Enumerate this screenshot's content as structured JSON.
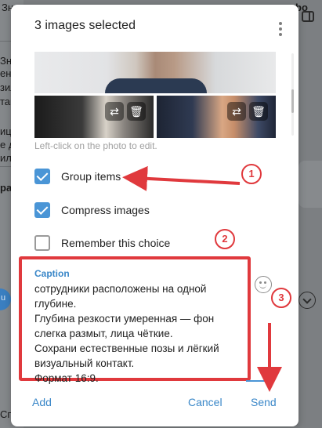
{
  "background": {
    "left_fragments": [
      "Зн",
      "ен",
      "зил",
      "тан",
      "иц",
      "е д",
      "ил,",
      "ра",
      "u",
      "Сп"
    ],
    "right_label_fragments": [
      "bo"
    ]
  },
  "dialog": {
    "title": "3 images selected",
    "menu_icon": "kebab-menu-icon",
    "hint": "Left-click on the photo to edit.",
    "photo_actions": [
      "replace-icon",
      "trash-icon"
    ],
    "options": [
      {
        "label": "Group items",
        "checked": true
      },
      {
        "label": "Compress images",
        "checked": true
      },
      {
        "label": "Remember this choice",
        "checked": false
      }
    ],
    "caption": {
      "label": "Caption",
      "text": "сотрудники расположены на одной глубине.\nГлубина резкости умеренная — фон слегка размыт, лица чёткие.\nСохрани естественные позы и лёгкий визуальный контакт.\nФормат 16:9."
    },
    "buttons": {
      "add": "Add",
      "cancel": "Cancel",
      "send": "Send"
    },
    "emoji_icon": "smiley-icon"
  },
  "annotations": {
    "badges": [
      "1",
      "2",
      "3"
    ],
    "accent_color": "#e0393d"
  },
  "colors": {
    "accent": "#4a95d6",
    "link": "#3a87c8",
    "annotation": "#e0393d"
  }
}
